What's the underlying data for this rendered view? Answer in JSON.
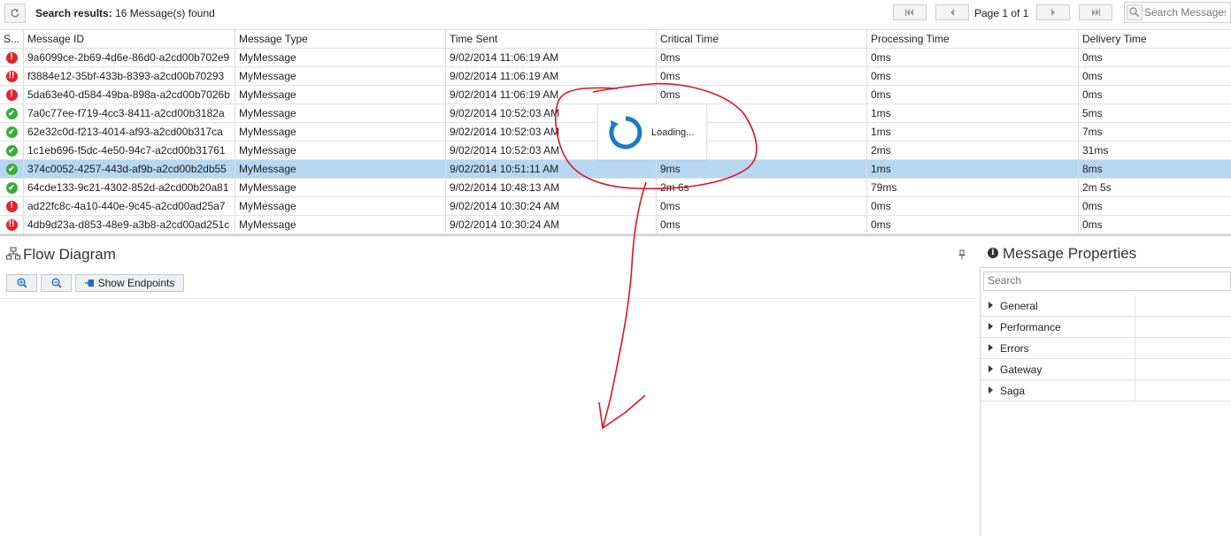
{
  "toolbar": {
    "search_results_label": "Search results:",
    "search_results_count": "16 Message(s) found",
    "page_label": "Page 1 of 1",
    "search_placeholder": "Search Messages"
  },
  "grid": {
    "columns": [
      "S...",
      "Message ID",
      "Message Type",
      "Time Sent",
      "Critical Time",
      "Processing Time",
      "Delivery Time"
    ],
    "rows": [
      {
        "status": "error",
        "id": "9a6099ce-2b69-4d6e-86d0-a2cd00b702e9",
        "type": "MyMessage",
        "time_sent": "9/02/2014 11:06:19 AM",
        "critical": "0ms",
        "processing": "0ms",
        "delivery": "0ms"
      },
      {
        "status": "repeated-error",
        "id": "f3884e12-35bf-433b-8393-a2cd00b70293",
        "type": "MyMessage",
        "time_sent": "9/02/2014 11:06:19 AM",
        "critical": "0ms",
        "processing": "0ms",
        "delivery": "0ms"
      },
      {
        "status": "error",
        "id": "5da63e40-d584-49ba-898a-a2cd00b7026b",
        "type": "MyMessage",
        "time_sent": "9/02/2014 11:06:19 AM",
        "critical": "0ms",
        "processing": "0ms",
        "delivery": "0ms"
      },
      {
        "status": "success",
        "id": "7a0c77ee-f719-4cc3-8411-a2cd00b3182a",
        "type": "MyMessage",
        "time_sent": "9/02/2014 10:52:03 AM",
        "critical": "",
        "processing": "1ms",
        "delivery": "5ms"
      },
      {
        "status": "success",
        "id": "62e32c0d-f213-4014-af93-a2cd00b317ca",
        "type": "MyMessage",
        "time_sent": "9/02/2014 10:52:03 AM",
        "critical": "",
        "processing": "1ms",
        "delivery": "7ms"
      },
      {
        "status": "success",
        "id": "1c1eb696-f5dc-4e50-94c7-a2cd00b31761",
        "type": "MyMessage",
        "time_sent": "9/02/2014 10:52:03 AM",
        "critical": "",
        "processing": "2ms",
        "delivery": "31ms"
      },
      {
        "status": "success",
        "id": "374c0052-4257-443d-af9b-a2cd00b2db55",
        "type": "MyMessage",
        "time_sent": "9/02/2014 10:51:11 AM",
        "critical": "9ms",
        "processing": "1ms",
        "delivery": "8ms",
        "selected": true
      },
      {
        "status": "success",
        "id": "64cde133-9c21-4302-852d-a2cd00b20a81",
        "type": "MyMessage",
        "time_sent": "9/02/2014 10:48:13 AM",
        "critical": "2m 6s",
        "processing": "79ms",
        "delivery": "2m 5s"
      },
      {
        "status": "error",
        "id": "ad22fc8c-4a10-440e-9c45-a2cd00ad25a7",
        "type": "MyMessage",
        "time_sent": "9/02/2014 10:30:24 AM",
        "critical": "0ms",
        "processing": "0ms",
        "delivery": "0ms"
      },
      {
        "status": "repeated-error",
        "id": "4db9d23a-d853-48e9-a3b8-a2cd00ad251c",
        "type": "MyMessage",
        "time_sent": "9/02/2014 10:30:24 AM",
        "critical": "0ms",
        "processing": "0ms",
        "delivery": "0ms"
      }
    ]
  },
  "loading": {
    "text": "Loading..."
  },
  "flow": {
    "title": "Flow Diagram",
    "show_endpoints_label": "Show Endpoints"
  },
  "properties": {
    "title": "Message Properties",
    "search_placeholder": "Search",
    "groups": [
      "General",
      "Performance",
      "Errors",
      "Gateway",
      "Saga"
    ]
  },
  "colors": {
    "selected_row": "#b5d7f2",
    "error": "#e0242a",
    "success": "#3cab3c",
    "spinner": "#1e78c8",
    "annotation": "#e0141e"
  }
}
